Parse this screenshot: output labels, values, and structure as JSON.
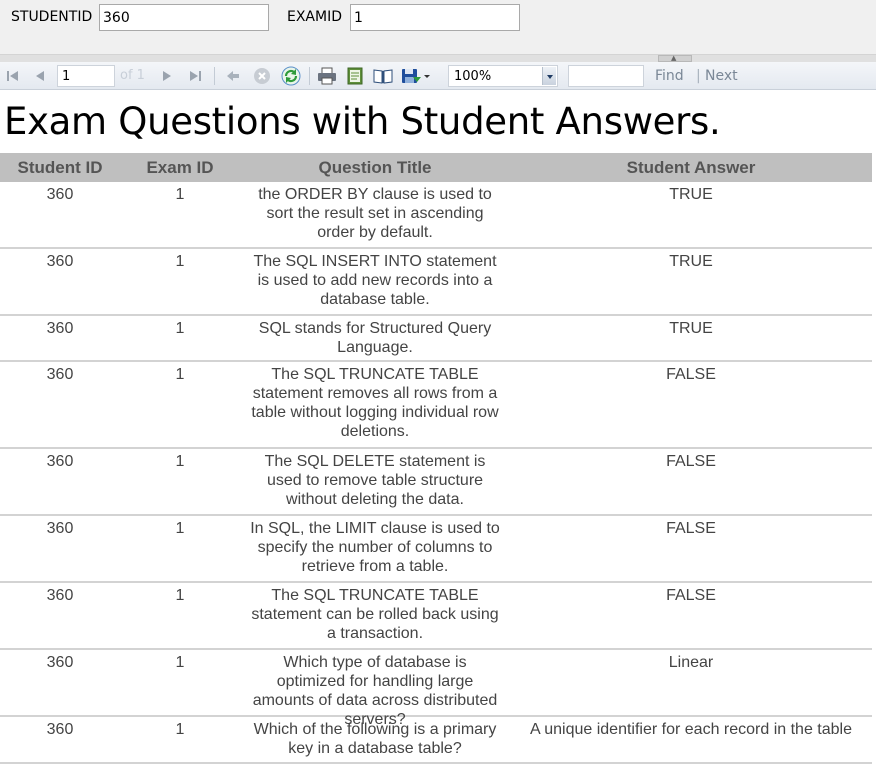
{
  "parameters": {
    "studentid_label": "STUDENTID",
    "studentid_value": "360",
    "examid_label": "EXAMID",
    "examid_value": "1"
  },
  "toolbar": {
    "page_value": "1",
    "page_of": "of 1",
    "zoom_value": "100%",
    "find_label": "Find",
    "find_separator": "|",
    "next_label": "Next",
    "icons": [
      "first-page-icon",
      "previous-page-icon",
      "next-page-icon",
      "last-page-icon",
      "back-icon",
      "stop-icon",
      "refresh-icon",
      "print-icon",
      "print-layout-icon",
      "page-setup-icon",
      "export-icon"
    ]
  },
  "report": {
    "title": "Exam Questions with Student Answers.",
    "columns": [
      "Student ID",
      "Exam ID",
      "Question Title",
      "Student Answer"
    ],
    "rows": [
      {
        "student_id": "360",
        "exam_id": "1",
        "question": "the ORDER BY clause is used to sort the result set in ascending order by default.",
        "answer": "TRUE"
      },
      {
        "student_id": "360",
        "exam_id": "1",
        "question": "The SQL INSERT INTO statement is used to add new records into a database table.",
        "answer": "TRUE"
      },
      {
        "student_id": "360",
        "exam_id": "1",
        "question": "SQL stands for Structured Query Language.",
        "answer": "TRUE"
      },
      {
        "student_id": "360",
        "exam_id": "1",
        "question": "The SQL TRUNCATE TABLE statement removes all rows from a table without logging individual row deletions.",
        "answer": "FALSE"
      },
      {
        "student_id": "360",
        "exam_id": "1",
        "question": "The SQL DELETE statement is used to remove table structure without deleting the data.",
        "answer": "FALSE"
      },
      {
        "student_id": "360",
        "exam_id": "1",
        "question": "In SQL, the LIMIT clause is used to specify the number of columns to retrieve from a table.",
        "answer": "FALSE"
      },
      {
        "student_id": "360",
        "exam_id": "1",
        "question": "The SQL TRUNCATE TABLE statement can be rolled back using a transaction.",
        "answer": "FALSE"
      },
      {
        "student_id": "360",
        "exam_id": "1",
        "question": "Which type of database is optimized for handling large amounts of data across distributed servers?",
        "answer": "Linear"
      },
      {
        "student_id": "360",
        "exam_id": "1",
        "question": "Which of the following is a primary key in a database table?",
        "answer": "A unique identifier for each record in the table"
      }
    ]
  },
  "colors": {
    "header_bg": "#bfbfbf",
    "header_text": "#555555",
    "cell_text": "#444444",
    "row_border": "#d3d3d3",
    "refresh_icon": "#2e9b3a",
    "export_icon": "#1f4e9c"
  }
}
